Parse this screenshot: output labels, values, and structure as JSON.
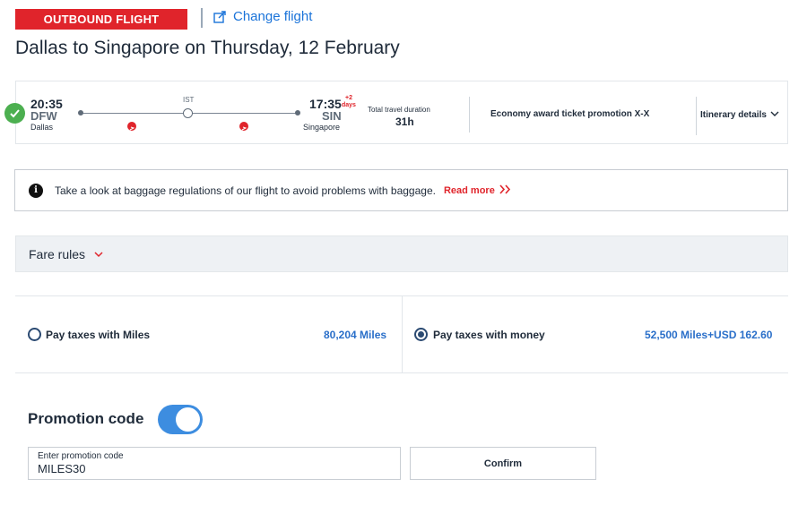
{
  "header": {
    "badge": "OUTBOUND FLIGHT",
    "change_flight": "Change flight",
    "route_title": "Dallas to Singapore on Thursday, 12 February"
  },
  "flight": {
    "departure": {
      "time": "20:35",
      "code": "DFW",
      "city": "Dallas"
    },
    "stop": {
      "code": "IST"
    },
    "arrival": {
      "time": "17:35",
      "days_offset": "+2",
      "days_label": "days",
      "code": "SIN",
      "city": "Singapore"
    },
    "duration_label": "Total travel duration",
    "duration_value": "31h",
    "fare_name": "Economy award ticket promotion X-X",
    "itinerary_link": "Itinerary details"
  },
  "notice": {
    "text": "Take a look at baggage regulations of our flight to avoid problems with baggage.",
    "link": "Read more"
  },
  "fare_rules": {
    "label": "Fare rules"
  },
  "payment": {
    "options": [
      {
        "label": "Pay taxes with Miles",
        "price": "80,204 Miles",
        "selected": false
      },
      {
        "label": "Pay taxes with money",
        "price": "52,500 Miles+USD 162.60",
        "selected": true
      }
    ]
  },
  "promotion": {
    "title": "Promotion code",
    "toggle_on": true,
    "input_label": "Enter promotion code",
    "input_value": "MILES30",
    "confirm_label": "Confirm"
  },
  "colors": {
    "brand_red": "#e0242b",
    "link_blue": "#1a73d9",
    "price_blue": "#2a6fc9",
    "toggle_blue": "#3d8de0",
    "success_green": "#4caf50"
  }
}
